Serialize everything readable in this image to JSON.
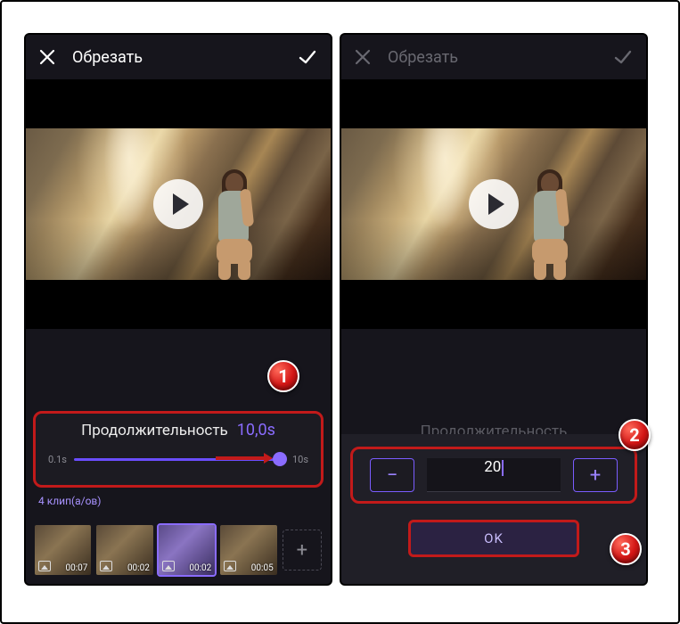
{
  "left": {
    "title": "Обрезать",
    "duration_label": "Продолжительность",
    "duration_value": "10,0s",
    "slider_min": "0.1s",
    "slider_max": "10s",
    "clip_count_label": "4 клип(а/ов)",
    "clips": [
      {
        "duration": "00:07"
      },
      {
        "duration": "00:02"
      },
      {
        "duration": "00:02"
      },
      {
        "duration": "00:05"
      }
    ],
    "add_label": "+"
  },
  "right": {
    "title": "Обрезать",
    "dim_duration_label": "Продолжительность",
    "stepper_value": "20",
    "minus": "−",
    "plus": "+",
    "ok_label": "OK"
  },
  "badges": {
    "b1": "1",
    "b2": "2",
    "b3": "3"
  }
}
